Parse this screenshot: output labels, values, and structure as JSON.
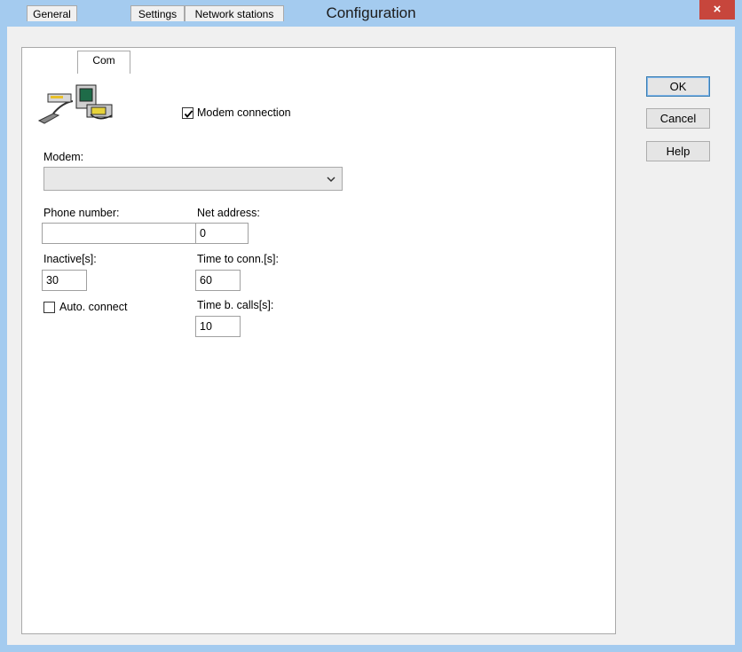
{
  "window": {
    "title": "Configuration",
    "close_glyph": "×"
  },
  "tabs": [
    {
      "label": "General",
      "active": false
    },
    {
      "label": "Com",
      "active": true
    },
    {
      "label": "Settings",
      "active": false
    },
    {
      "label": "Network stations",
      "active": false
    }
  ],
  "buttons": {
    "ok": "OK",
    "cancel": "Cancel",
    "help": "Help"
  },
  "com": {
    "icon": "modem-computer-icon",
    "modem_connection": {
      "label": "Modem connection",
      "checked": true
    },
    "modem": {
      "label": "Modem:",
      "value": ""
    },
    "phone_number": {
      "label": "Phone number:",
      "value": ""
    },
    "net_address": {
      "label": "Net address:",
      "value": "0"
    },
    "inactive": {
      "label": "Inactive[s]:",
      "value": "30"
    },
    "time_to_conn": {
      "label": "Time to conn.[s]:",
      "value": "60"
    },
    "auto_connect": {
      "label": "Auto. connect",
      "checked": false
    },
    "time_b_calls": {
      "label": "Time b. calls[s]:",
      "value": "10"
    }
  },
  "colors": {
    "titlebar": "#a4cbef",
    "close": "#c7463c",
    "dialog_bg": "#f0f0f0"
  }
}
